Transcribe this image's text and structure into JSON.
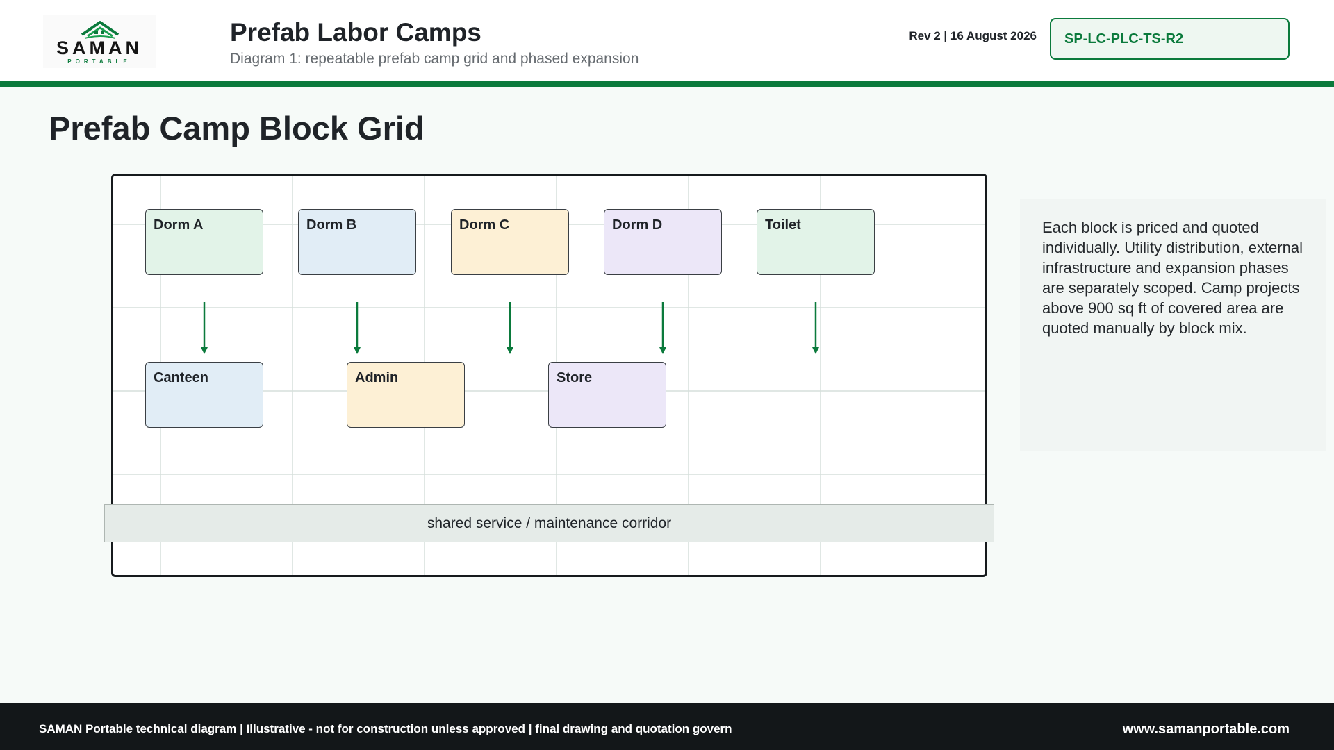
{
  "header": {
    "logo": {
      "word": "SAMAN",
      "sub": "PORTABLE"
    },
    "title": "Prefab Labor Camps",
    "subtitle": "Diagram 1: repeatable prefab camp grid and phased expansion",
    "revision": "Rev 2 | 16 August 2026",
    "document_id": "SP-LC-PLC-TS-R2"
  },
  "section": {
    "title": "Prefab Camp Block Grid"
  },
  "diagram": {
    "top_row": [
      {
        "label": "Dorm A",
        "color": "#e2f3e8"
      },
      {
        "label": "Dorm B",
        "color": "#e1edf6"
      },
      {
        "label": "Dorm C",
        "color": "#fdf0d5"
      },
      {
        "label": "Dorm D",
        "color": "#ece7f8"
      },
      {
        "label": "Toilet",
        "color": "#e2f3e8"
      }
    ],
    "bottom_row": [
      {
        "label": "Canteen",
        "color": "#e1edf6"
      },
      {
        "label": "Admin",
        "color": "#fdf0d5"
      },
      {
        "label": "Store",
        "color": "#ece7f8"
      }
    ],
    "corridor_label": "shared service / maintenance corridor",
    "arrow_color": "#0b7a3c",
    "grid_color": "#d5dfdb"
  },
  "note": {
    "text": "Each block is priced and quoted individually. Utility distribution, external infrastructure and expansion phases are separately scoped. Camp projects above 900 sq ft of covered area are quoted manually by block mix."
  },
  "footer": {
    "left": "SAMAN Portable technical diagram | Illustrative - not for construction unless approved | final drawing and quotation govern",
    "right": "www.samanportable.com"
  },
  "colors": {
    "brand_green": "#0b7a3c",
    "footer_bg": "#131719"
  }
}
